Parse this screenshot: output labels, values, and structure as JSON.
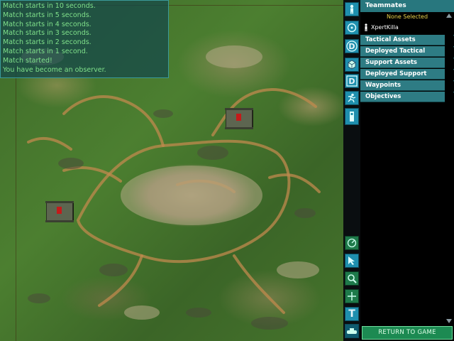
{
  "chat": {
    "lines": [
      "Match starts in 10 seconds.",
      "Match starts in 5 seconds.",
      "Match starts in 4 seconds.",
      "Match starts in 3 seconds.",
      "Match starts in 2 seconds.",
      "Match starts in 1 second.",
      "Match started!",
      "You have become an observer."
    ]
  },
  "sidebar": {
    "title": "Teammates",
    "selection": "None Selected",
    "player": "XpertKilla",
    "sections": [
      "Tactical Assets",
      "Deployed Tactical",
      "Support Assets",
      "Deployed Support",
      "Waypoints",
      "Objectives"
    ]
  },
  "toolbar": {
    "top_icons": [
      "soldier-icon",
      "compass-icon",
      "deploy-d-icon",
      "cube-icon",
      "deploy-d2-icon",
      "sprint-icon",
      "tower-icon"
    ],
    "bottom_icons": [
      "radar-icon",
      "pointer-icon",
      "zoom-icon",
      "crosshair-icon",
      "text-t-icon",
      "tank-icon"
    ],
    "d_label": "D",
    "t_label": "T"
  },
  "return_button": "RETURN TO GAME",
  "colors": {
    "chat_text": "#7fe08a",
    "panel_teal": "#2e7c84",
    "button_green": "#1c8a52"
  }
}
